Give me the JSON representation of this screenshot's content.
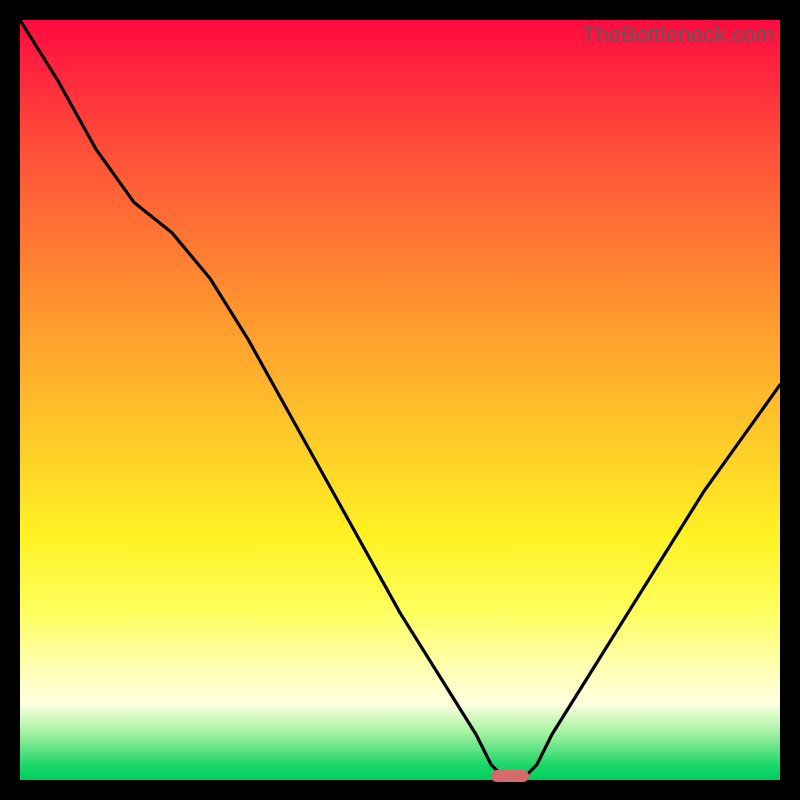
{
  "watermark": "TheBottleneck.com",
  "colors": {
    "frame": "#000000",
    "marker": "#d46a6a",
    "curve": "#000000"
  },
  "chart_data": {
    "type": "line",
    "title": "",
    "xlabel": "",
    "ylabel": "",
    "xlim": [
      0,
      100
    ],
    "ylim": [
      0,
      100
    ],
    "series": [
      {
        "name": "bottleneck-curve",
        "x": [
          0,
          5,
          10,
          15,
          20,
          25,
          30,
          35,
          40,
          45,
          50,
          55,
          60,
          62,
          64,
          66,
          68,
          70,
          75,
          80,
          85,
          90,
          95,
          100
        ],
        "values": [
          100,
          92,
          83,
          76,
          72,
          66,
          58,
          49,
          40,
          31,
          22,
          14,
          6,
          2,
          0,
          0,
          2,
          6,
          14,
          22,
          30,
          38,
          45,
          52
        ]
      }
    ],
    "marker": {
      "x_start": 62,
      "x_end": 67,
      "y": 0
    },
    "gradient_stops": [
      {
        "pct": 0,
        "color": "#ff0a40"
      },
      {
        "pct": 68,
        "color": "#fff224"
      },
      {
        "pct": 100,
        "color": "#00cf5c"
      }
    ]
  }
}
